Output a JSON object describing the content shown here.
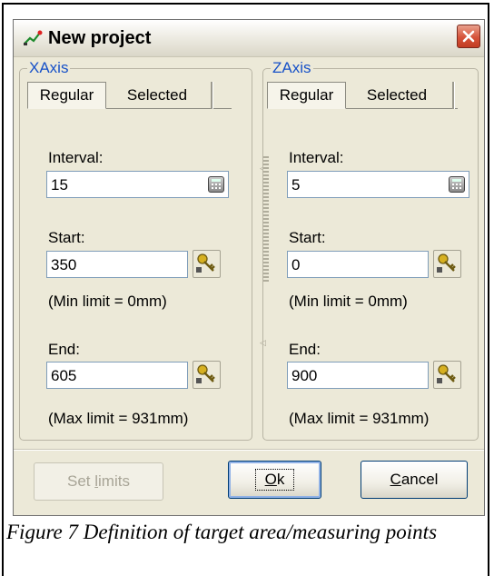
{
  "window": {
    "title": "New project",
    "icon": "chart-icon",
    "close_icon": "close-icon"
  },
  "xaxis": {
    "group_label": "XAxis",
    "tabs": [
      "Regular",
      "Selected"
    ],
    "active_tab": "Regular",
    "interval_label": "Interval:",
    "interval_value": "15",
    "start_label": "Start:",
    "start_value": "350",
    "min_limit": "(Min limit = 0mm)",
    "end_label": "End:",
    "end_value": "605",
    "max_limit": "(Max limit = 931mm)"
  },
  "zaxis": {
    "group_label": "ZAxis",
    "tabs": [
      "Regular",
      "Selected"
    ],
    "active_tab": "Regular",
    "interval_label": "Interval:",
    "interval_value": "5",
    "start_label": "Start:",
    "start_value": "0",
    "min_limit": "(Min limit = 0mm)",
    "end_label": "End:",
    "end_value": "900",
    "max_limit": "(Max limit = 931mm)"
  },
  "buttons": {
    "set_limits_pre": "Set ",
    "set_limits_u": "l",
    "set_limits_post": "imits",
    "ok_u": "O",
    "ok_post": "k",
    "cancel_u": "C",
    "cancel_post": "ancel"
  },
  "icons": {
    "calculator": "calculator-icon",
    "key": "key-icon"
  },
  "caption": "Figure 7 Definition of target area/measuring points"
}
